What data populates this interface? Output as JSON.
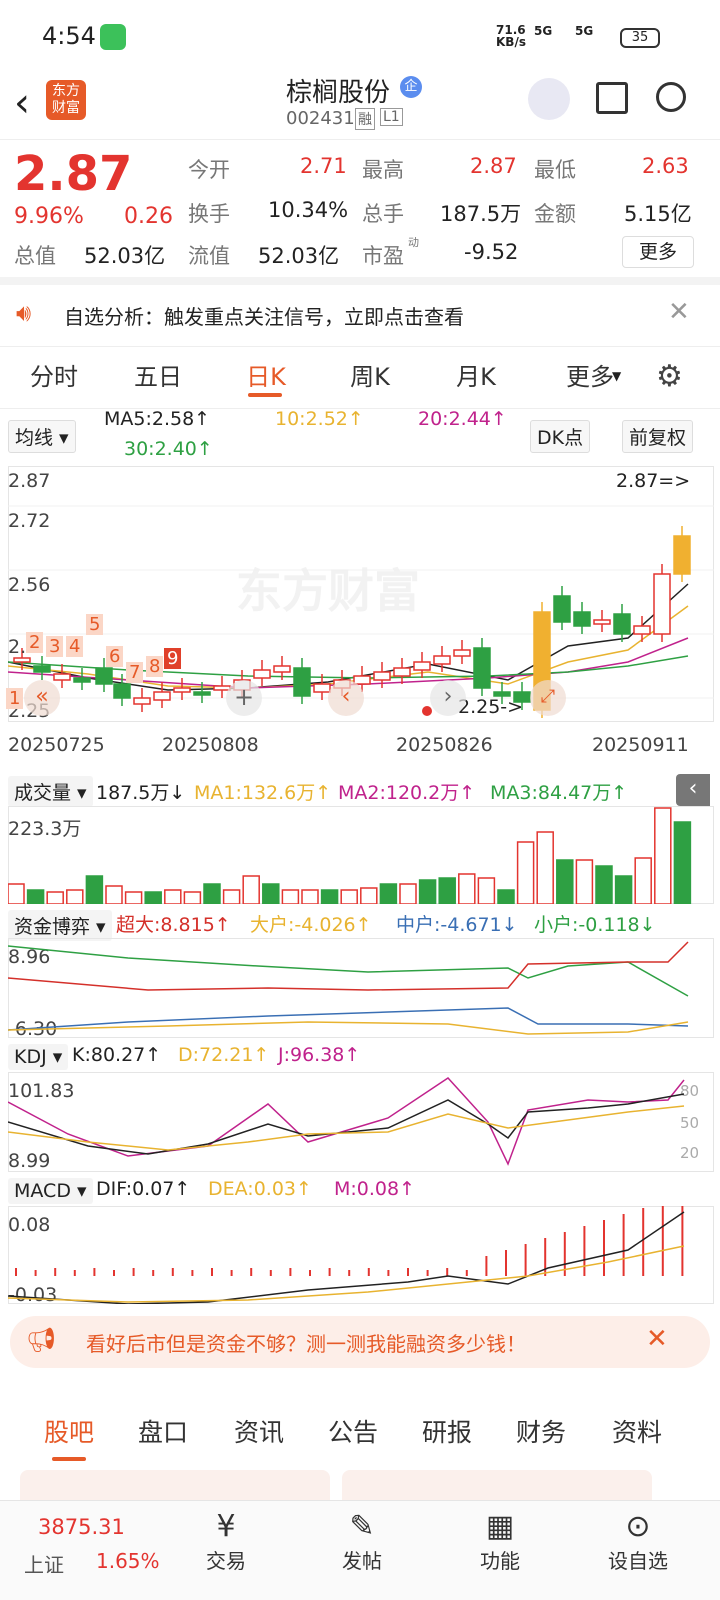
{
  "status": {
    "time": "4:54",
    "net_speed_value": "71.6",
    "net_speed_unit": "KB/s",
    "signal1": "5G",
    "signal2": "5G",
    "battery": "35"
  },
  "header": {
    "logo_text": "东方财富",
    "title": "棕榈股份",
    "title_badge": "企",
    "code": "002431",
    "tag1": "融",
    "tag2": "L1"
  },
  "quote": {
    "price": "2.87",
    "change_pct": "9.96%",
    "change": "0.26",
    "open_label": "今开",
    "open": "2.71",
    "high_label": "最高",
    "high": "2.87",
    "low_label": "最低",
    "low": "2.63",
    "turnover_label": "换手",
    "turnover": "10.34%",
    "volume_label": "总手",
    "volume": "187.5万",
    "amount_label": "金额",
    "amount": "5.15亿",
    "mktcap_label": "总值",
    "mktcap": "52.03亿",
    "float_label": "流值",
    "float": "52.03亿",
    "pe_label": "市盈",
    "pe_sup": "动",
    "pe": "-9.52",
    "more_label": "更多"
  },
  "alert": {
    "text": "自选分析：触发重点关注信号，立即点击查看"
  },
  "tabs": [
    "分时",
    "五日",
    "日K",
    "周K",
    "月K",
    "更多"
  ],
  "active_tab_index": 2,
  "ma_bar": {
    "selector": "均线",
    "ma5": "MA5:2.58↑",
    "ma10": "10:2.52↑",
    "ma20": "20:2.44↑",
    "ma30": "30:2.40↑",
    "dk": "DK点",
    "fq": "前复权"
  },
  "kchart": {
    "y_labels": [
      "2.87",
      "2.72",
      "2.56",
      "2.4",
      "2.25"
    ],
    "x_labels": [
      "20250725",
      "20250808",
      "20250826",
      "20250911"
    ],
    "max_marker": "2.87=>",
    "min_marker": "2.25->",
    "signal_numbers": [
      "1",
      "2",
      "3",
      "4",
      "5",
      "6",
      "7",
      "8",
      "9"
    ],
    "watermark": "东方财富"
  },
  "volume": {
    "selector": "成交量",
    "value": "187.5万↓",
    "ma1": "MA1:132.6万↑",
    "ma2": "MA2:120.2万↑",
    "ma3": "MA3:84.47万↑",
    "y_label": "223.3万"
  },
  "fund": {
    "selector": "资金博弈",
    "super": "超大:8.815↑",
    "large": "大户:-4.026↑",
    "mid": "中户:-4.671↓",
    "small": "小户:-0.118↓",
    "y_top": "8.96",
    "y_bottom": "-6.30"
  },
  "kdj": {
    "selector": "KDJ",
    "k": "K:80.27↑",
    "d": "D:72.21↑",
    "j": "J:96.38↑",
    "y_top": "101.83",
    "y_bottom": "8.99",
    "lv80": "80",
    "lv50": "50",
    "lv20": "20"
  },
  "macd": {
    "selector": "MACD",
    "dif": "DIF:0.07↑",
    "dea": "DEA:0.03↑",
    "m": "M:0.08↑",
    "y_top": "0.08",
    "y_bottom": "-0.03"
  },
  "banner2": {
    "text": "看好后市但是资金不够？测一测我能融资多少钱！"
  },
  "bottom_tabs": [
    "股吧",
    "盘口",
    "资讯",
    "公告",
    "研报",
    "财务",
    "资料"
  ],
  "footer": {
    "index_value": "3875.31",
    "index_name": "上证",
    "index_change": "1.65%",
    "items": [
      "交易",
      "发帖",
      "功能",
      "设自选"
    ]
  },
  "colors": {
    "up": "#e3342f",
    "down": "#2ea043",
    "accent": "#e65a28"
  }
}
